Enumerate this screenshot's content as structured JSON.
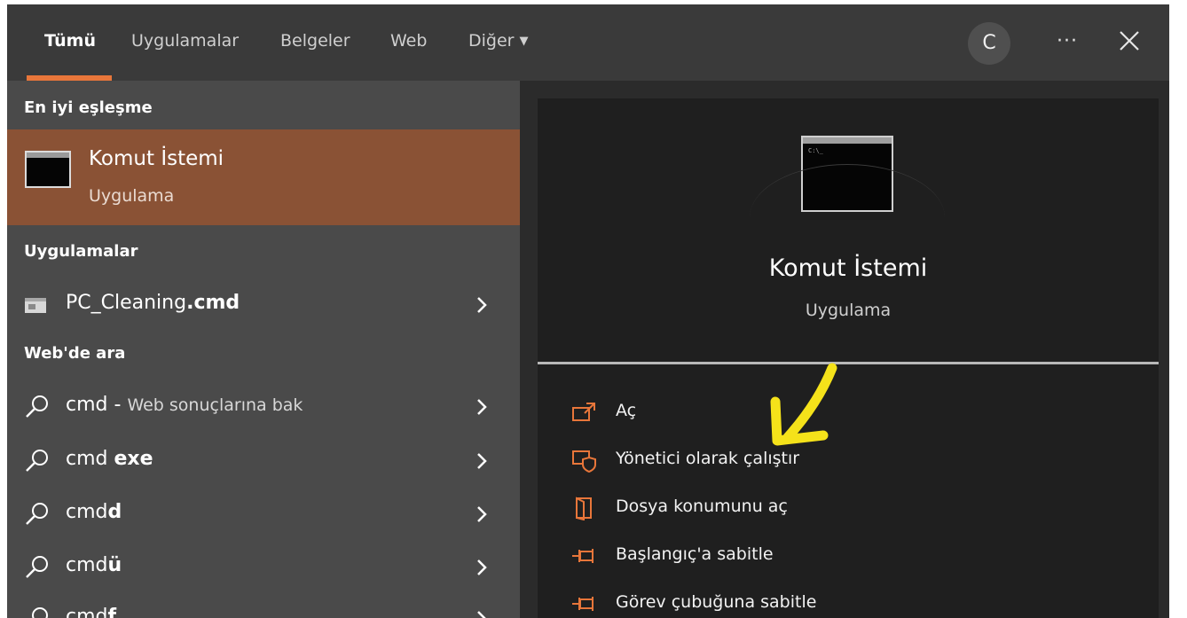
{
  "tabs": [
    {
      "label": "Tümü",
      "active": true
    },
    {
      "label": "Uygulamalar"
    },
    {
      "label": "Belgeler"
    },
    {
      "label": "Web"
    },
    {
      "label": "Diğer"
    }
  ],
  "header": {
    "avatar_letter": "C",
    "more_label": "···"
  },
  "left": {
    "best_match_heading": "En iyi eşleşme",
    "best_match": {
      "name": "Komut İstemi",
      "type": "Uygulama"
    },
    "apps_heading": "Uygulamalar",
    "app_result": {
      "name": "PC_Cleaning",
      "ext": ".cmd"
    },
    "web_heading": "Web'de ara",
    "web_results": [
      {
        "query": "cmd",
        "suffix": " - ",
        "sub": "Web sonuçlarına bak"
      },
      {
        "query": "cmd ",
        "bold": "exe"
      },
      {
        "query": "cmd",
        "bold": "d"
      },
      {
        "query": "cmd",
        "bold": "ü"
      },
      {
        "query": "cmd",
        "bold": "f"
      }
    ]
  },
  "detail": {
    "name": "Komut İstemi",
    "type": "Uygulama",
    "actions": [
      {
        "label": "Aç",
        "icon": "open-icon"
      },
      {
        "label": "Yönetici olarak çalıştır",
        "icon": "shield-admin-icon"
      },
      {
        "label": "Dosya konumunu aç",
        "icon": "file-location-icon"
      },
      {
        "label": "Başlangıç'a sabitle",
        "icon": "pin-icon"
      },
      {
        "label": "Görev çubuğuna sabitle",
        "icon": "pin-icon"
      }
    ]
  },
  "colors": {
    "accent": "#e8763a",
    "best_match_bg": "#8a5235",
    "annotation_arrow": "#f5e21a"
  }
}
